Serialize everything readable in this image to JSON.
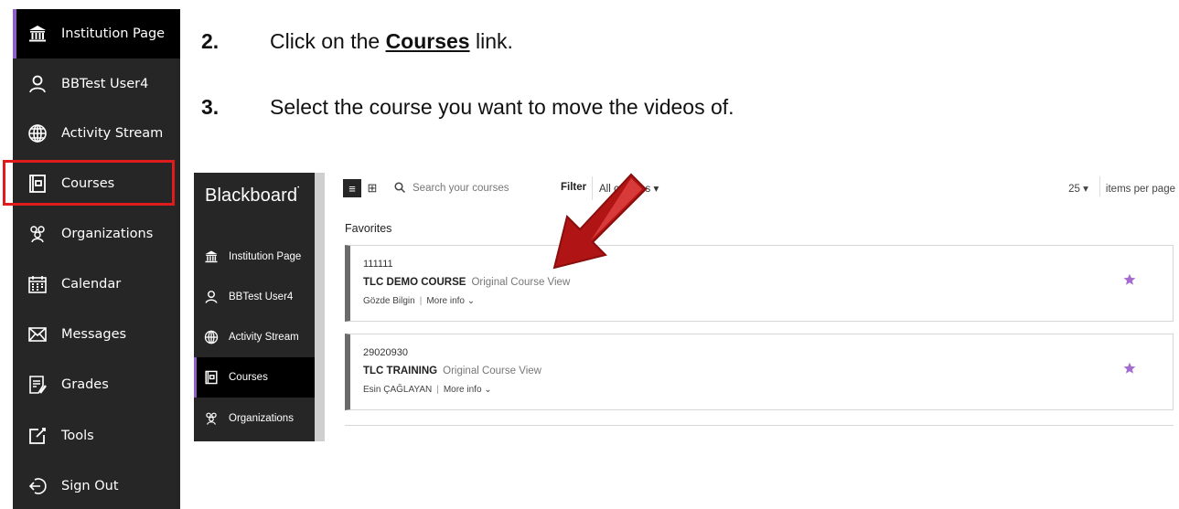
{
  "left_nav": {
    "items": [
      {
        "label": "Institution Page",
        "icon": "institution-icon",
        "active": true
      },
      {
        "label": "BBTest User4",
        "icon": "user-icon"
      },
      {
        "label": "Activity Stream",
        "icon": "globe-icon"
      },
      {
        "label": "Courses",
        "icon": "courses-icon"
      },
      {
        "label": "Organizations",
        "icon": "organizations-icon"
      },
      {
        "label": "Calendar",
        "icon": "calendar-icon"
      },
      {
        "label": "Messages",
        "icon": "envelope-icon"
      },
      {
        "label": "Grades",
        "icon": "grades-icon"
      },
      {
        "label": "Tools",
        "icon": "tools-icon"
      },
      {
        "label": "Sign Out",
        "icon": "sign-out-icon"
      }
    ],
    "highlight_color": "#e01b1b",
    "active_accent": "#8f5fc7"
  },
  "instructions": {
    "step2": {
      "number": "2.",
      "before": "Click on the ",
      "link": "Courses",
      "after": " link."
    },
    "step3": {
      "number": "3.",
      "text": "Select the course you want to move the videos of."
    }
  },
  "screenshot": {
    "brand": "Blackboard",
    "nav_items": [
      {
        "label": "Institution Page",
        "icon": "institution-icon"
      },
      {
        "label": "BBTest User4",
        "icon": "user-icon"
      },
      {
        "label": "Activity Stream",
        "icon": "globe-icon"
      },
      {
        "label": "Courses",
        "icon": "courses-icon",
        "active": true
      },
      {
        "label": "Organizations",
        "icon": "organizations-icon"
      }
    ],
    "toolbar": {
      "search_placeholder": "Search your courses",
      "filter_label": "Filter",
      "filter_value": "All courses",
      "items_per_page_value": "25",
      "items_per_page_label": "items per page"
    },
    "section_title": "Favorites",
    "courses": [
      {
        "id": "111111",
        "title": "TLC DEMO COURSE",
        "view": "Original Course View",
        "instructor": "Gözde Bilgin",
        "more": "More info"
      },
      {
        "id": "29020930",
        "title": "TLC TRAINING",
        "view": "Original Course View",
        "instructor": "Esin ÇAĞLAYAN",
        "more": "More info"
      }
    ],
    "star_color": "#a46bd0",
    "arrow_color": "#c01818"
  }
}
